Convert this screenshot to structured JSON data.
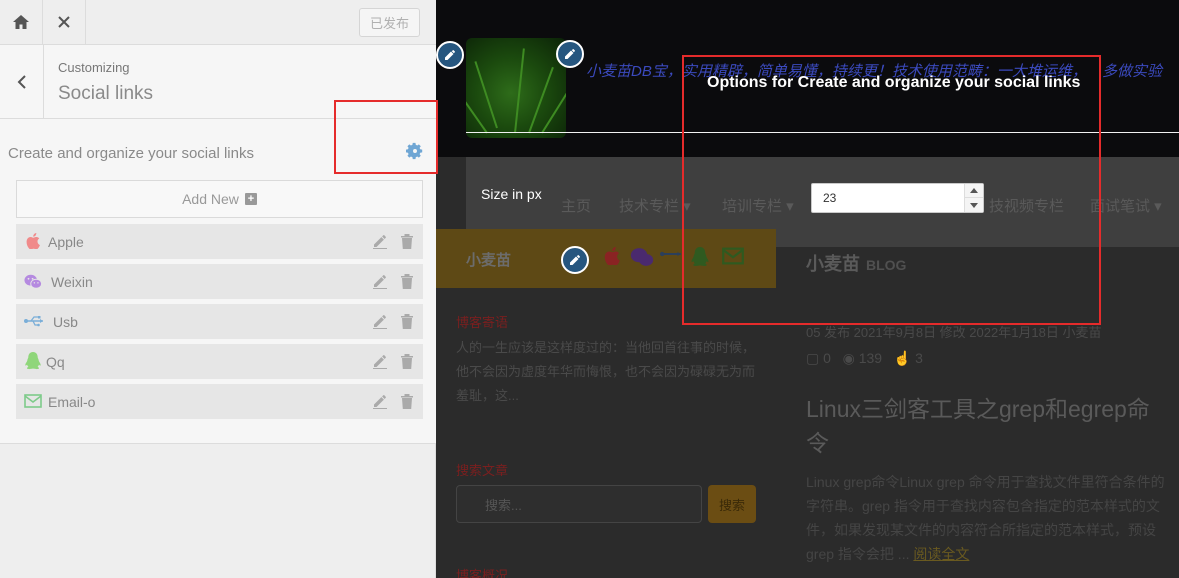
{
  "topbar": {
    "publish_label": "已发布"
  },
  "section": {
    "breadcrumb": "Customizing",
    "title": "Social links"
  },
  "control": {
    "label": "Create and organize your social links",
    "add_new_label": "Add New",
    "links": [
      {
        "label": "Apple",
        "icon": "apple-icon",
        "color": "#f08a8a"
      },
      {
        "label": "Weixin",
        "icon": "weixin-icon",
        "color": "#b58ae0"
      },
      {
        "label": "Usb",
        "icon": "usb-icon",
        "color": "#7aaed8"
      },
      {
        "label": "Qq",
        "icon": "qq-icon",
        "color": "#8fd67a"
      },
      {
        "label": "Email-o",
        "icon": "email-icon",
        "color": "#7ecb8a"
      }
    ]
  },
  "options_panel": {
    "title": "Options for Create and organize your social links",
    "size_label": "Size in px",
    "size_value": "23"
  },
  "preview": {
    "tagline": "小麦苗DB宝，实用精辟，简单易懂，持续更！技术使用范畴：一大堆运维，",
    "tagline_2": "多做实验",
    "nav": [
      "主页",
      "技术专栏 ▾",
      "培训专栏 ▾",
      "技视频专栏",
      "面试笔试 ▾"
    ],
    "sidebar_title": "小麦苗",
    "blog_title": "小麦苗",
    "blog_subtitle": "BLOG",
    "section_1": "博客寄语",
    "section_1_text": "人的一生应该是这样度过的：当他回首往事的时候，他不会因为虚度年华而悔恨，也不会因为碌碌无为而羞耻，这...",
    "section_2": "搜索文章",
    "search_placeholder": "搜索...",
    "search_button": "搜索",
    "section_3": "博客概况",
    "meta_line": "05 发布 2021年9月8日 修改 2022年1月18日 小麦苗",
    "meta_comments": "0",
    "meta_views": "139",
    "meta_likes": "3",
    "article_title": "Linux三剑客工具之grep和egrep命令",
    "article_body": "Linux grep命令Linux grep 命令用于查找文件里符合条件的字符串。grep 指令用于查找内容包含指定的范本样式的文件，如果发现某文件的内容符合所指定的范本样式，预设 grep 指令会把 ...",
    "read_more": "阅读全文"
  }
}
